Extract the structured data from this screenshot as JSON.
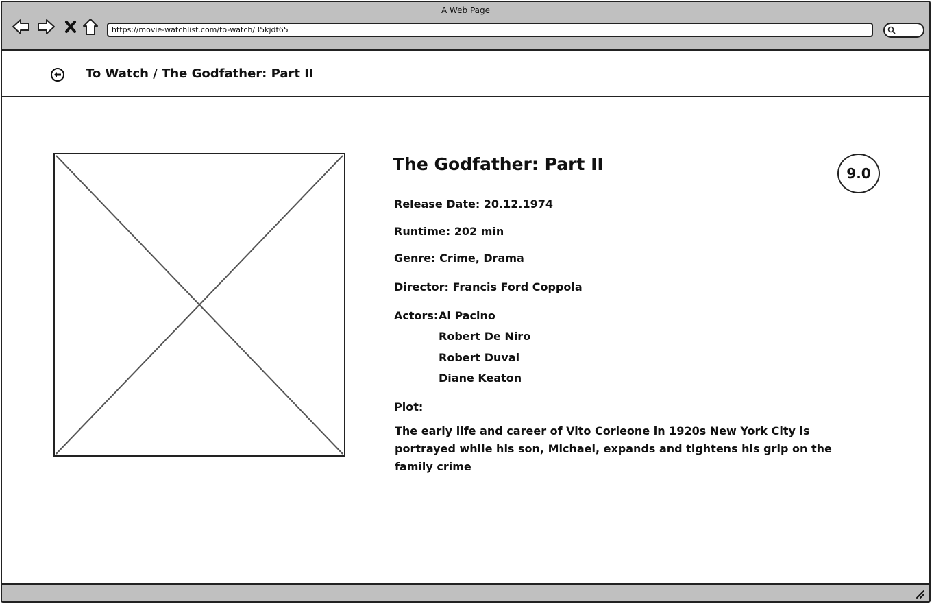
{
  "window": {
    "title": "A Web Page",
    "url": "https://movie-watchlist.com/to-watch/35kjdt65"
  },
  "toolbar": {
    "icons": [
      "back-arrow-icon",
      "forward-arrow-icon",
      "close-icon",
      "home-icon",
      "search-icon"
    ]
  },
  "header": {
    "back_icon": "circle-arrow-left-icon",
    "breadcrumb": "To Watch / The Godfather: Part II"
  },
  "movie": {
    "title": "The Godfather: Part II",
    "rating": "9.0",
    "release_date": "Release Date: 20.12.1974",
    "runtime": "Runtime: 202 min",
    "genre": "Genre: Crime, Drama",
    "director": "Director: Francis Ford Coppola",
    "actors_label": "Actors:",
    "actors": [
      "Al Pacino",
      "Robert De Niro",
      "Robert Duval",
      "Diane Keaton"
    ],
    "plot_label": "Plot:",
    "plot": "The early life and career of Vito Corleone in 1920s New York City is portrayed while his son, Michael, expands and tightens his grip on the family crime"
  }
}
